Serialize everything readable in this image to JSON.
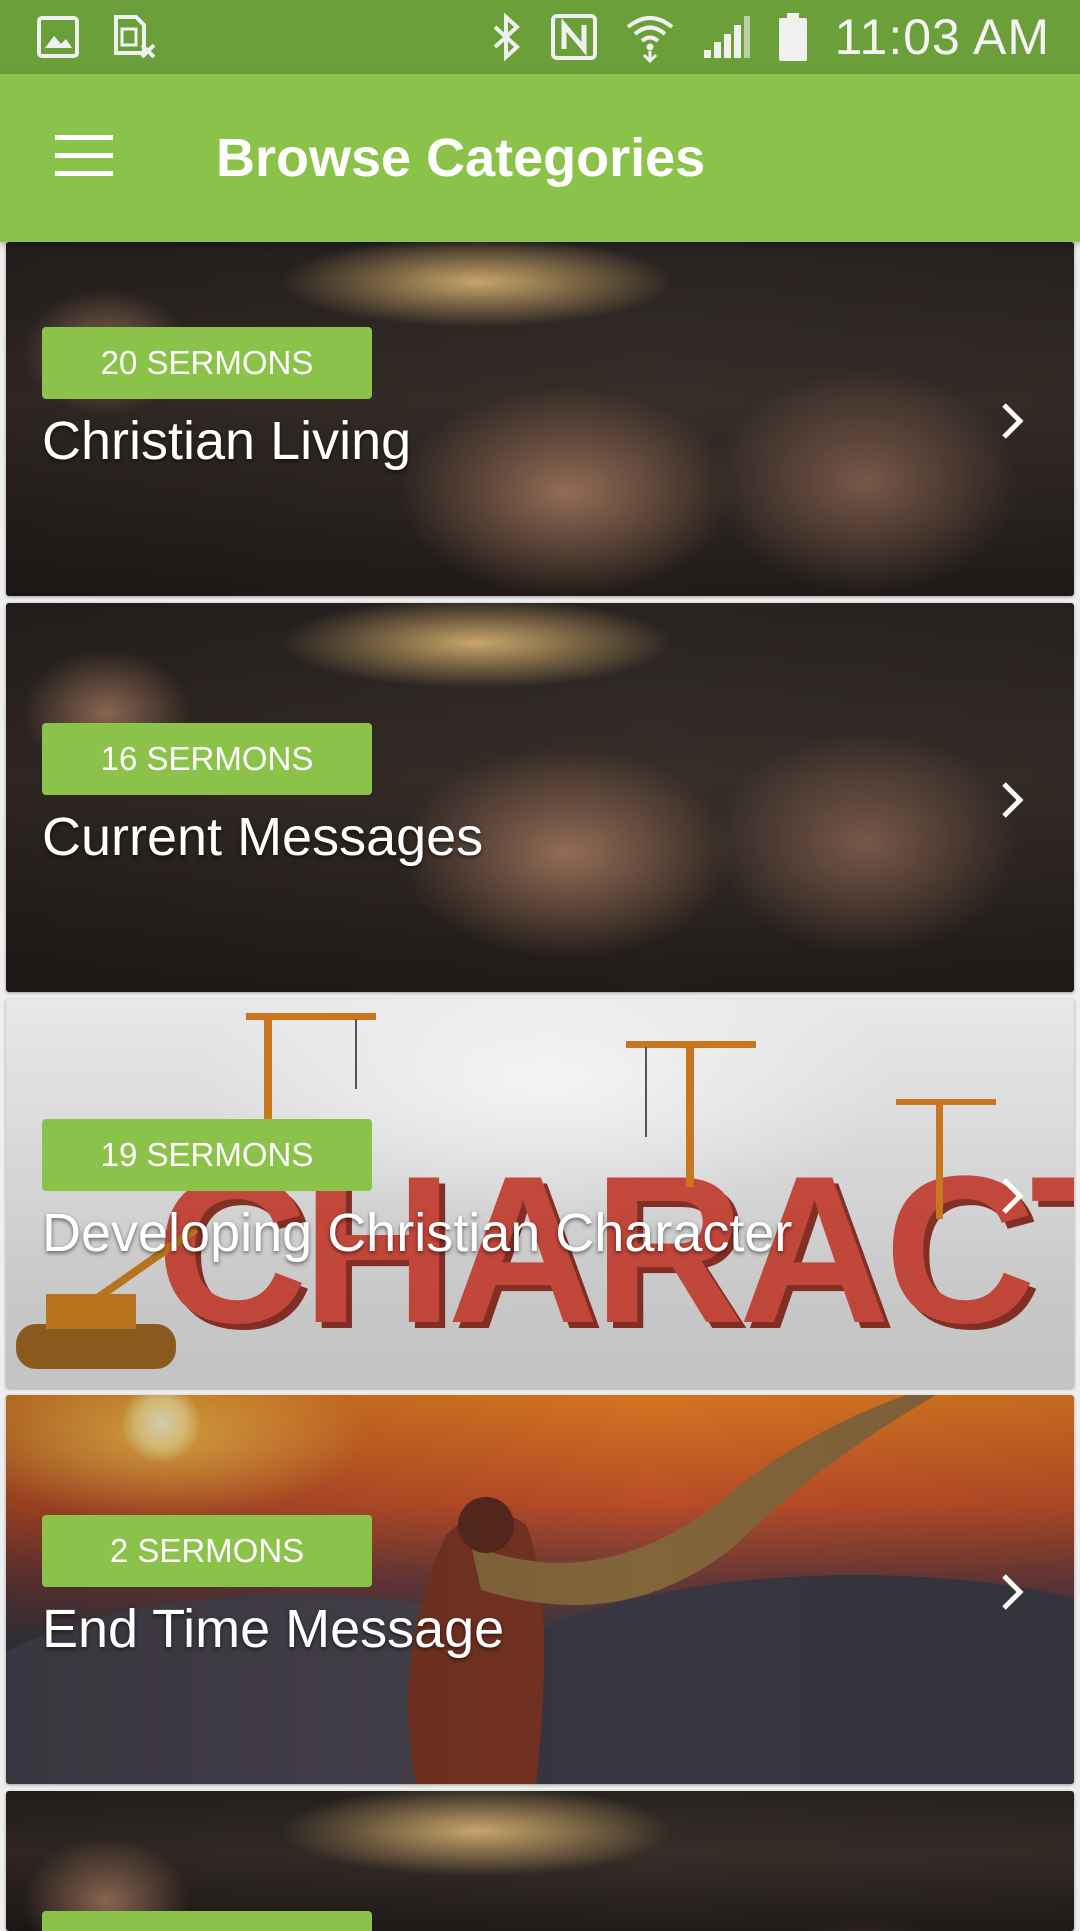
{
  "status_bar": {
    "time": "11:03 AM",
    "left_icons": [
      "image-icon",
      "sim-card-x-icon"
    ],
    "right_icons": [
      "bluetooth-icon",
      "nfc-icon",
      "wifi-icon",
      "cellular-signal-icon",
      "battery-icon"
    ]
  },
  "app_bar": {
    "title": "Browse Categories",
    "menu_icon": "hamburger-menu-icon"
  },
  "colors": {
    "status_bar": "#6a9f3a",
    "app_bar": "#8bc34a",
    "badge": "#8bc34a"
  },
  "categories": [
    {
      "count_label": "20 SERMONS",
      "title": "Christian Living",
      "image": "bible-hands"
    },
    {
      "count_label": "16 SERMONS",
      "title": "Current Messages",
      "image": "bible-hands"
    },
    {
      "count_label": "19 SERMONS",
      "title": "Developing Christian Character",
      "image": "character-cranes"
    },
    {
      "count_label": "2 SERMONS",
      "title": "End Time Message",
      "image": "shofar-sunset"
    },
    {
      "count_label": "",
      "title": "",
      "image": "bible-hands"
    }
  ],
  "character_image_text": "CHARACTER"
}
